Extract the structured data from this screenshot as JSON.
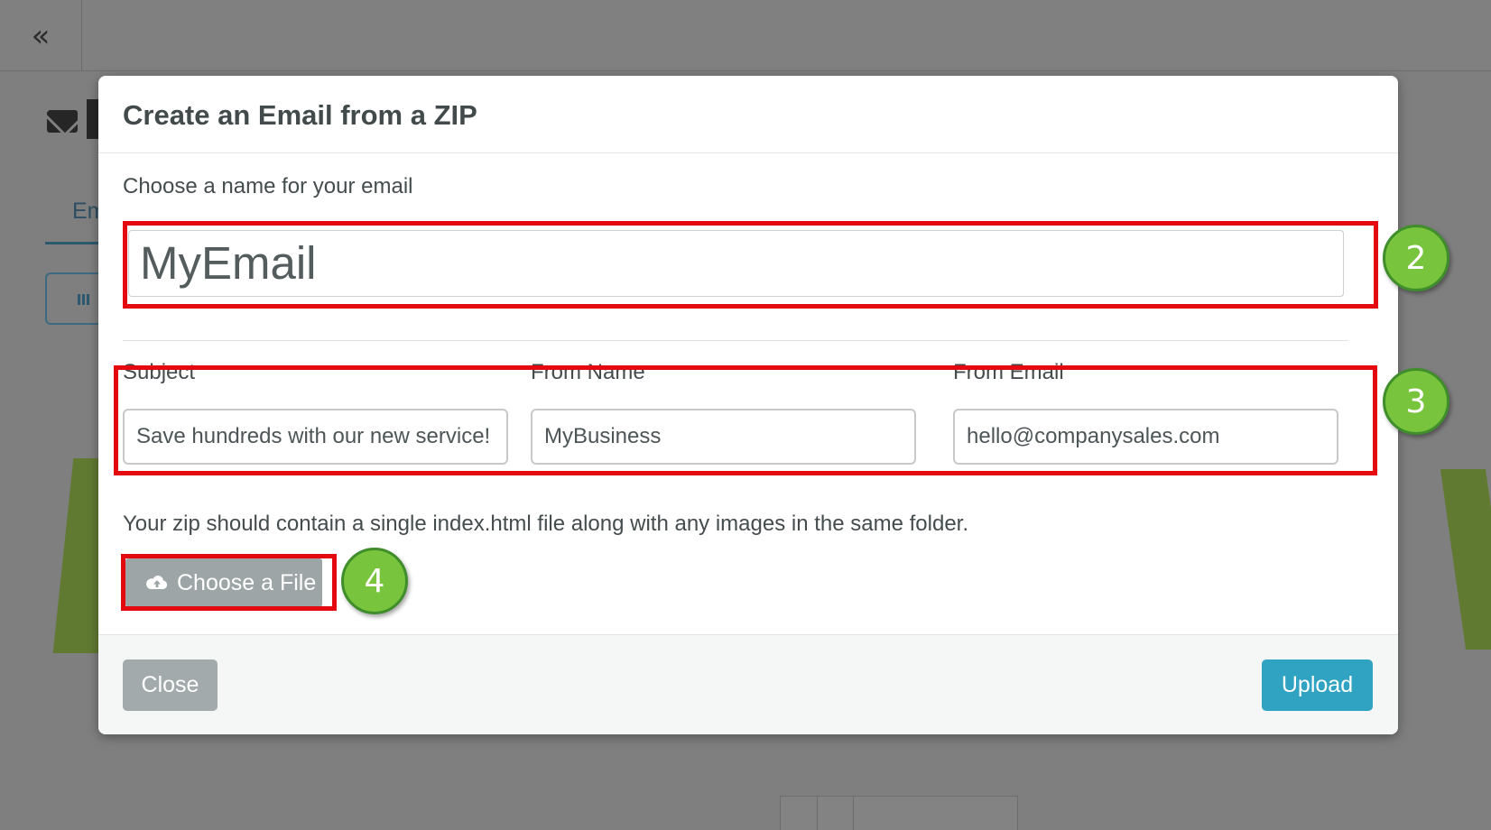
{
  "background": {
    "collapse_glyph": "«",
    "tab_fragment": "Em"
  },
  "modal": {
    "title": "Create an Email from a ZIP",
    "name_label": "Choose a name for your email",
    "name_value": "MyEmail",
    "subject_label": "Subject",
    "subject_value": "Save hundreds with our new service!",
    "from_name_label": "From Name",
    "from_name_value": "MyBusiness",
    "from_email_label": "From Email",
    "from_email_value": "hello@companysales.com",
    "help_text": "Your zip should contain a single index.html file along with any images in the same folder.",
    "choose_file_label": "Choose a File",
    "choose_file_icon": "cloud-upload-icon",
    "close_label": "Close",
    "upload_label": "Upload"
  },
  "annotations": {
    "badges": [
      "2",
      "3",
      "4"
    ],
    "highlight_color": "#e3090f",
    "badge_color": "#78c43d"
  },
  "colors": {
    "upload_button": "#2fa3c1",
    "close_button": "#a3aaac",
    "choose_file_button": "#9ea5a7",
    "overlay": "#7f7f7f"
  }
}
